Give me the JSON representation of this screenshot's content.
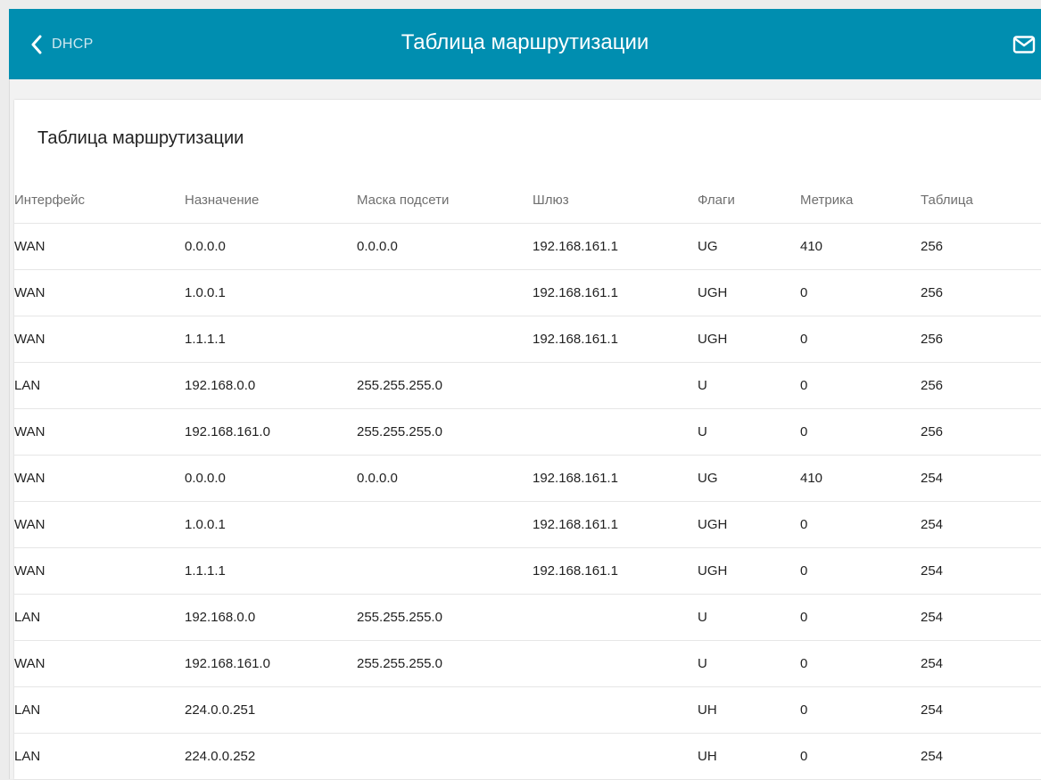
{
  "header": {
    "back_label": "DHCP",
    "title": "Таблица маршрутизации",
    "mail_icon": "envelope-icon"
  },
  "card": {
    "title": "Таблица маршрутизации"
  },
  "table": {
    "columns": [
      "Интерфейс",
      "Назначение",
      "Маска подсети",
      "Шлюз",
      "Флаги",
      "Метрика",
      "Таблица"
    ],
    "rows": [
      [
        "WAN",
        "0.0.0.0",
        "0.0.0.0",
        "192.168.161.1",
        "UG",
        "410",
        "256"
      ],
      [
        "WAN",
        "1.0.0.1",
        "",
        "192.168.161.1",
        "UGH",
        "0",
        "256"
      ],
      [
        "WAN",
        "1.1.1.1",
        "",
        "192.168.161.1",
        "UGH",
        "0",
        "256"
      ],
      [
        "LAN",
        "192.168.0.0",
        "255.255.255.0",
        "",
        "U",
        "0",
        "256"
      ],
      [
        "WAN",
        "192.168.161.0",
        "255.255.255.0",
        "",
        "U",
        "0",
        "256"
      ],
      [
        "WAN",
        "0.0.0.0",
        "0.0.0.0",
        "192.168.161.1",
        "UG",
        "410",
        "254"
      ],
      [
        "WAN",
        "1.0.0.1",
        "",
        "192.168.161.1",
        "UGH",
        "0",
        "254"
      ],
      [
        "WAN",
        "1.1.1.1",
        "",
        "192.168.161.1",
        "UGH",
        "0",
        "254"
      ],
      [
        "LAN",
        "192.168.0.0",
        "255.255.255.0",
        "",
        "U",
        "0",
        "254"
      ],
      [
        "WAN",
        "192.168.161.0",
        "255.255.255.0",
        "",
        "U",
        "0",
        "254"
      ],
      [
        "LAN",
        "224.0.0.251",
        "",
        "",
        "UH",
        "0",
        "254"
      ],
      [
        "LAN",
        "224.0.0.252",
        "",
        "",
        "UH",
        "0",
        "254"
      ]
    ]
  },
  "colors": {
    "header_bg": "#008eb0",
    "page_bg": "#f2f2f2",
    "card_bg": "#ffffff",
    "text": "#222222",
    "header_text_muted": "#6f6f6f"
  }
}
